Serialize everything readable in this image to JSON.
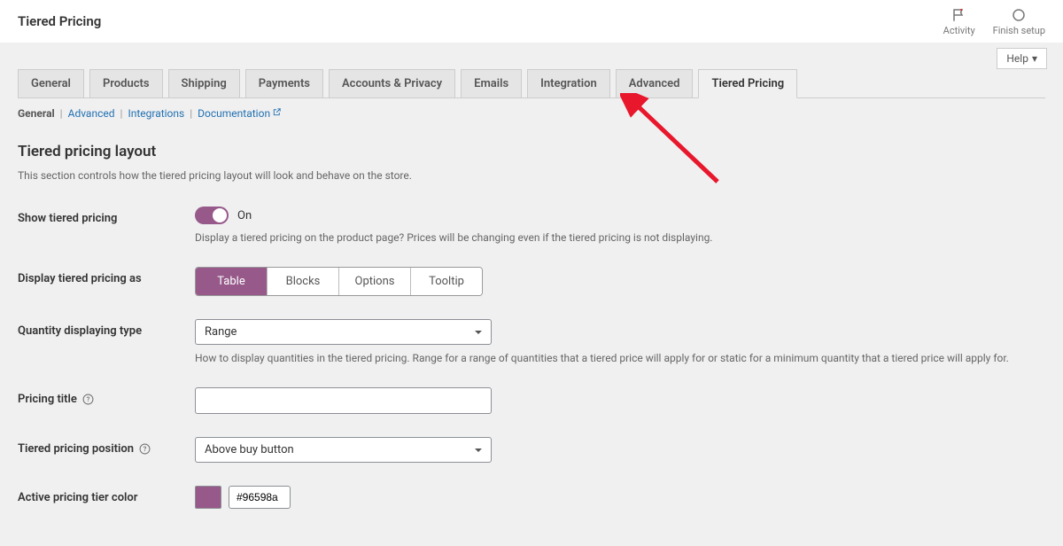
{
  "header": {
    "title": "Tiered Pricing",
    "actions": [
      {
        "label": "Activity"
      },
      {
        "label": "Finish setup"
      }
    ],
    "help": "Help"
  },
  "tabs": [
    {
      "label": "General"
    },
    {
      "label": "Products"
    },
    {
      "label": "Shipping"
    },
    {
      "label": "Payments"
    },
    {
      "label": "Accounts & Privacy"
    },
    {
      "label": "Emails"
    },
    {
      "label": "Integration"
    },
    {
      "label": "Advanced"
    },
    {
      "label": "Tiered Pricing",
      "active": true
    }
  ],
  "subnav": [
    {
      "label": "General",
      "current": true
    },
    {
      "label": "Advanced"
    },
    {
      "label": "Integrations"
    },
    {
      "label": "Documentation",
      "external": true
    }
  ],
  "section": {
    "title": "Tiered pricing layout",
    "desc": "This section controls how the tiered pricing layout will look and behave on the store."
  },
  "fields": {
    "show": {
      "label": "Show tiered pricing",
      "state": "On",
      "help": "Display a tiered pricing on the product page? Prices will be changing even if the tiered pricing is not displaying."
    },
    "displayAs": {
      "label": "Display tiered pricing as",
      "options": [
        "Table",
        "Blocks",
        "Options",
        "Tooltip"
      ],
      "active": 0
    },
    "qtyType": {
      "label": "Quantity displaying type",
      "value": "Range",
      "help": "How to display quantities in the tiered pricing. Range for a range of quantities that a tiered price will apply for or static for a minimum quantity that a tiered price will apply for."
    },
    "title": {
      "label": "Pricing title",
      "value": ""
    },
    "position": {
      "label": "Tiered pricing position",
      "value": "Above buy button"
    },
    "color": {
      "label": "Active pricing tier color",
      "value": "#96598a"
    }
  }
}
